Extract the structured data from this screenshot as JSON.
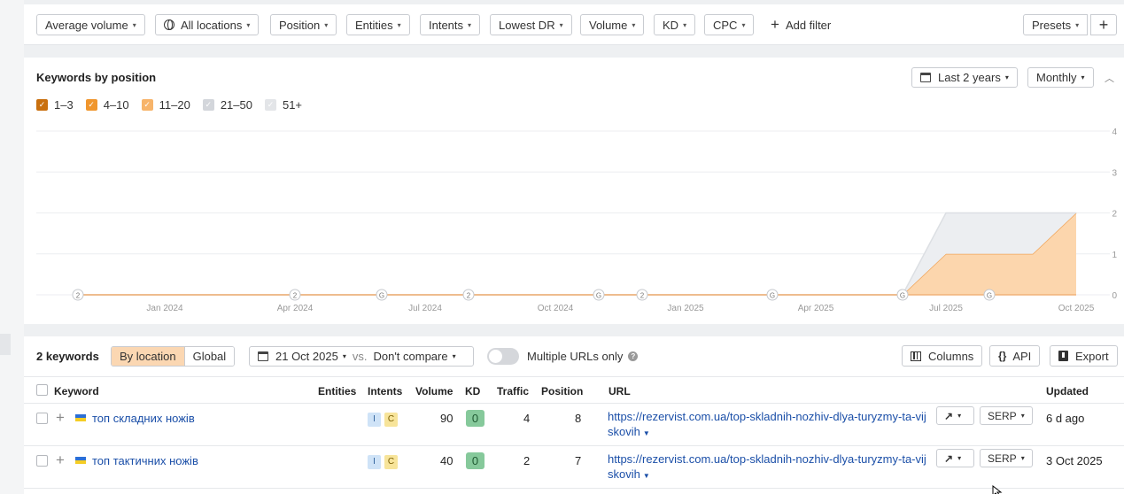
{
  "filters": {
    "items": [
      "Average volume",
      "All locations",
      "Position",
      "Entities",
      "Intents",
      "Lowest DR",
      "Volume",
      "KD",
      "CPC"
    ],
    "add_filter": "Add filter",
    "presets": "Presets",
    "plus": "+"
  },
  "chart_panel": {
    "title": "Keywords by position",
    "range": "Last 2 years",
    "interval": "Monthly",
    "collapse_icon": "chevron-up-icon",
    "legend": [
      {
        "label": "1–3",
        "color": "#c9700f"
      },
      {
        "label": "4–10",
        "color": "#f0962d"
      },
      {
        "label": "11–20",
        "color": "#f7b46a"
      },
      {
        "label": "21–50",
        "color": "#d3d6db"
      },
      {
        "label": "51+",
        "color": "#e3e5e8"
      }
    ]
  },
  "chart_data": {
    "type": "area",
    "x": [
      "Nov 2023",
      "Dec 2023",
      "Jan 2024",
      "Feb 2024",
      "Mar 2024",
      "Apr 2024",
      "May 2024",
      "Jun 2024",
      "Jul 2024",
      "Aug 2024",
      "Sep 2024",
      "Oct 2024",
      "Nov 2024",
      "Dec 2024",
      "Jan 2025",
      "Feb 2025",
      "Mar 2025",
      "Apr 2025",
      "May 2025",
      "Jun 2025",
      "Jul 2025",
      "Aug 2025",
      "Sep 2025",
      "Oct 2025"
    ],
    "x_tick_labels": [
      "Jan 2024",
      "Apr 2024",
      "Jul 2024",
      "Oct 2024",
      "Jan 2025",
      "Apr 2025",
      "Jul 2025",
      "Oct 2025"
    ],
    "y_tick_labels": [
      "0",
      "1",
      "2",
      "3",
      "4"
    ],
    "ylim": [
      0,
      4
    ],
    "series": [
      {
        "name": "1–3",
        "values": [
          0,
          0,
          0,
          0,
          0,
          0,
          0,
          0,
          0,
          0,
          0,
          0,
          0,
          0,
          0,
          0,
          0,
          0,
          0,
          0,
          0,
          0,
          0,
          0
        ]
      },
      {
        "name": "4–10",
        "values": [
          0,
          0,
          0,
          0,
          0,
          0,
          0,
          0,
          0,
          0,
          0,
          0,
          0,
          0,
          0,
          0,
          0,
          0,
          0,
          0,
          0,
          0,
          0,
          0
        ]
      },
      {
        "name": "11–20",
        "values": [
          0,
          0,
          0,
          0,
          0,
          0,
          0,
          0,
          0,
          0,
          0,
          0,
          0,
          0,
          0,
          0,
          0,
          0,
          0,
          0,
          1,
          1,
          1,
          2
        ]
      },
      {
        "name": "21–50",
        "values": [
          0,
          0,
          0,
          0,
          0,
          0,
          0,
          0,
          0,
          0,
          0,
          0,
          0,
          0,
          0,
          0,
          0,
          0,
          0,
          0,
          1,
          1,
          1,
          0
        ]
      },
      {
        "name": "51+",
        "values": [
          0,
          0,
          0,
          0,
          0,
          0,
          0,
          0,
          0,
          0,
          0,
          0,
          0,
          0,
          0,
          0,
          0,
          0,
          0,
          0,
          0,
          0,
          0,
          0
        ]
      }
    ],
    "annotations": [
      {
        "x": "Nov 2023",
        "label": "2"
      },
      {
        "x": "Apr 2024",
        "label": "2"
      },
      {
        "x": "Jun 2024",
        "label": "G"
      },
      {
        "x": "Aug 2024",
        "label": "2"
      },
      {
        "x": "Nov 2024",
        "label": "G"
      },
      {
        "x": "Dec 2024",
        "label": "2"
      },
      {
        "x": "Mar 2025",
        "label": "G"
      },
      {
        "x": "Jun 2025",
        "label": "G"
      },
      {
        "x": "Aug 2025",
        "label": "G"
      }
    ],
    "grid": true
  },
  "table_panel": {
    "count": "2 keywords",
    "by_location": "By location",
    "global": "Global",
    "date": "21 Oct 2025",
    "vs": "vs.",
    "compare": "Don't compare",
    "multiple_urls": "Multiple URLs only",
    "help": "?",
    "columns": "Columns",
    "api": "API",
    "api_icon": "{}",
    "export": "Export",
    "headers": {
      "keyword": "Keyword",
      "entities": "Entities",
      "intents": "Intents",
      "volume": "Volume",
      "kd": "KD",
      "traffic": "Traffic",
      "position": "Position",
      "url": "URL",
      "updated": "Updated"
    },
    "rows": [
      {
        "keyword": "топ складних ножів",
        "intent_i": "I",
        "intent_c": "C",
        "volume": "90",
        "kd": "0",
        "traffic": "4",
        "position": "8",
        "url": "https://rezervist.com.ua/top-skladnih-nozhiv-dlya-turyzmy-ta-vijskovih",
        "serp": "SERP",
        "updated": "6 d ago"
      },
      {
        "keyword": "топ тактичних ножів",
        "intent_i": "I",
        "intent_c": "C",
        "volume": "40",
        "kd": "0",
        "traffic": "2",
        "position": "7",
        "url": "https://rezervist.com.ua/top-skladnih-nozhiv-dlya-turyzmy-ta-vijskovih",
        "serp": "SERP",
        "updated": "3 Oct 2025"
      }
    ]
  }
}
